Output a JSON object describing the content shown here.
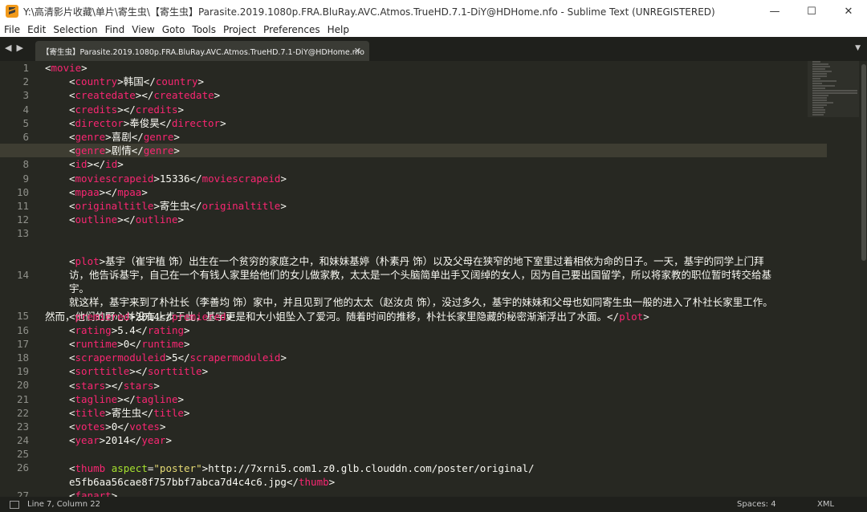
{
  "window": {
    "title": "Y:\\高清影片收藏\\单片\\寄生虫\\【寄生虫】Parasite.2019.1080p.FRA.BluRay.AVC.Atmos.TrueHD.7.1-DiY@HDHome.nfo - Sublime Text (UNREGISTERED)",
    "minimize_glyph": "—",
    "maximize_glyph": "☐",
    "close_glyph": "✕"
  },
  "menu": [
    "File",
    "Edit",
    "Selection",
    "Find",
    "View",
    "Goto",
    "Tools",
    "Project",
    "Preferences",
    "Help"
  ],
  "tab": {
    "label": "【寄生虫】Parasite.2019.1080p.FRA.BluRay.AVC.Atmos.TrueHD.7.1-DiY@HDHome.nfo",
    "close_glyph": "✕"
  },
  "nav": {
    "back_glyph": "◀",
    "forward_glyph": "▶",
    "dropdown_glyph": "▼"
  },
  "editor": {
    "line_numbers": [
      "1",
      "2",
      "3",
      "4",
      "5",
      "6",
      "7",
      "8",
      "9",
      "10",
      "11",
      "12",
      "13",
      "",
      "",
      "14",
      "",
      "",
      "15",
      "16",
      "17",
      "18",
      "19",
      "20",
      "21",
      "22",
      "23",
      "24",
      "25",
      "26",
      "",
      "27"
    ],
    "lines": {
      "l1": "movie",
      "l2_tag": "country",
      "l2_val": "韩国",
      "l3_tag": "createdate",
      "l4_tag": "credits",
      "l5_tag": "director",
      "l5_val": "奉俊昊",
      "l6_tag": "genre",
      "l6_val": "喜剧",
      "l7_tag": "genre",
      "l7_val": "剧情",
      "l8_tag": "id",
      "l9_tag": "moviescrapeid",
      "l9_val": "15336",
      "l10_tag": "mpaa",
      "l11_tag": "originaltitle",
      "l11_val": "寄生虫",
      "l12_tag": "outline",
      "l13_tag": "plot",
      "l13_text": "基宇（崔宇植 饰）出生在一个贫穷的家庭之中，和妹妹基婷（朴素丹 饰）以及父母在狭窄的地下室里过着相依为命的日子。一天，基宇的同学上门拜访，他告诉基宇，自己在一个有钱人家里给他们的女儿做家教，太太是一个头脑简单出手又阔绰的女人，因为自己要出国留学，所以将家教的职位暂时转交给基宇。",
      "l14_text": "就这样，基宇来到了朴社长（李善均 饰）家中，并且见到了他的太太（赵汝贞 饰），没过多久，基宇的妹妹和父母也如同寄生虫一般的进入了朴社长家里工作。然而，他们的野心并没有止步于此，基宇更是和大小姐坠入了爱河。随着时间的推移，朴社长家里隐藏的秘密渐渐浮出了水面。",
      "l15_tag": "premiered",
      "l15_val": "2014",
      "l16_tag": "rating",
      "l16_val": "5.4",
      "l17_tag": "runtime",
      "l17_val": "0",
      "l18_tag": "scrapermoduleid",
      "l18_val": "5",
      "l19_tag": "sorttitle",
      "l20_tag": "stars",
      "l21_tag": "tagline",
      "l22_tag": "title",
      "l22_val": "寄生虫",
      "l23_tag": "votes",
      "l23_val": "0",
      "l24_tag": "year",
      "l24_val": "2014",
      "l26_tag": "thumb",
      "l26_attr": "aspect",
      "l26_attrval": "\"poster\"",
      "l26_val1": "http://7xrni5.com1.z0.glb.clouddn.com/poster/original/",
      "l26_val2": "e5fb6aa56cae8f757bbf7abca7d4c4c6.jpg",
      "l27_tag": "fanart"
    }
  },
  "status": {
    "position": "Line 7, Column 22",
    "spaces": "Spaces: 4",
    "syntax": "XML"
  },
  "colors": {
    "background": "#272822",
    "tag": "#f92672",
    "attribute": "#a6e22e",
    "string": "#e6db74",
    "text": "#f8f8f2"
  }
}
